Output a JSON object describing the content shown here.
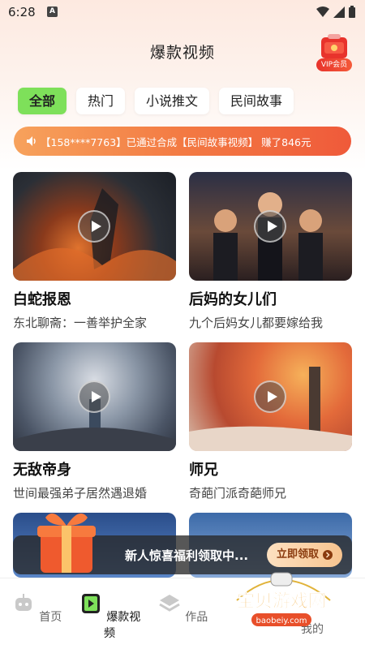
{
  "status": {
    "time": "6:28",
    "notif": "A"
  },
  "page": {
    "title": "爆款视频"
  },
  "vip": {
    "label": "VIP会员"
  },
  "tabs": [
    {
      "label": "全部",
      "active": true
    },
    {
      "label": "热门"
    },
    {
      "label": "小说推文"
    },
    {
      "label": "民间故事"
    }
  ],
  "marquee": {
    "text": "【158****7763】已通过合成【民间故事视频】 赚了846元"
  },
  "cards": [
    {
      "title": "白蛇报恩",
      "subtitle": "东北聊斋：一善举护全家"
    },
    {
      "title": "后妈的女儿们",
      "subtitle": "九个后妈女儿都要嫁给我"
    },
    {
      "title": "无敌帝身",
      "subtitle": "世间最强弟子居然遇退婚"
    },
    {
      "title": "师兄",
      "subtitle": "奇葩门派奇葩师兄"
    }
  ],
  "promo": {
    "text": "新人惊喜福利领取中...",
    "button": "立即领取"
  },
  "nav": [
    {
      "label": "首页"
    },
    {
      "label": "爆款视频",
      "active": true
    },
    {
      "label": "作品"
    },
    {
      "label": "我的"
    }
  ],
  "watermark": {
    "title": "宝贝游戏网",
    "url": "baobeiy.com"
  },
  "colors": {
    "accent_green": "#7ee05a",
    "promo_orange": "#f37a43",
    "vip_red": "#e8332c"
  }
}
